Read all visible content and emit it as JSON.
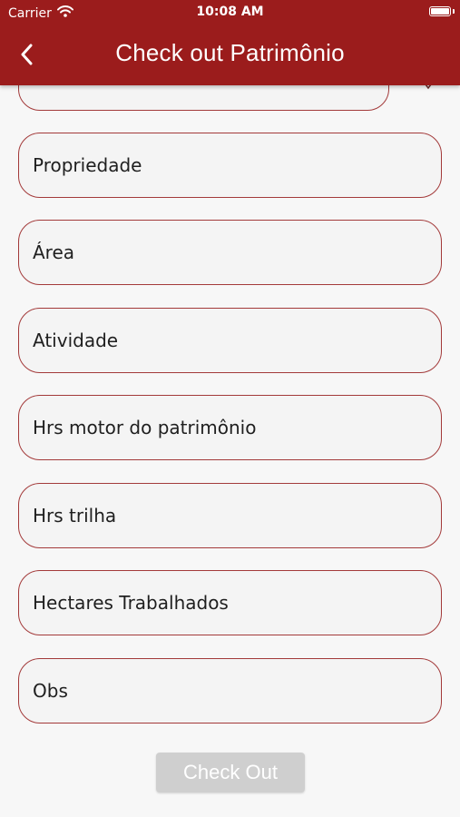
{
  "status_bar": {
    "carrier": "Carrier",
    "time": "10:08 AM"
  },
  "header": {
    "title": "Check out Patrimônio",
    "background_color": "#9b1c1c"
  },
  "form": {
    "partial_field_label": "",
    "fields": [
      {
        "label": "Propriedade"
      },
      {
        "label": "Área"
      },
      {
        "label": "Atividade"
      },
      {
        "label": "Hrs motor do patrimônio"
      },
      {
        "label": "Hrs trilha"
      },
      {
        "label": "Hectares Trabalhados"
      },
      {
        "label": "Obs"
      }
    ],
    "border_color": "#a33a3a"
  },
  "actions": {
    "checkout_label": "Check Out",
    "checkout_disabled": true
  }
}
